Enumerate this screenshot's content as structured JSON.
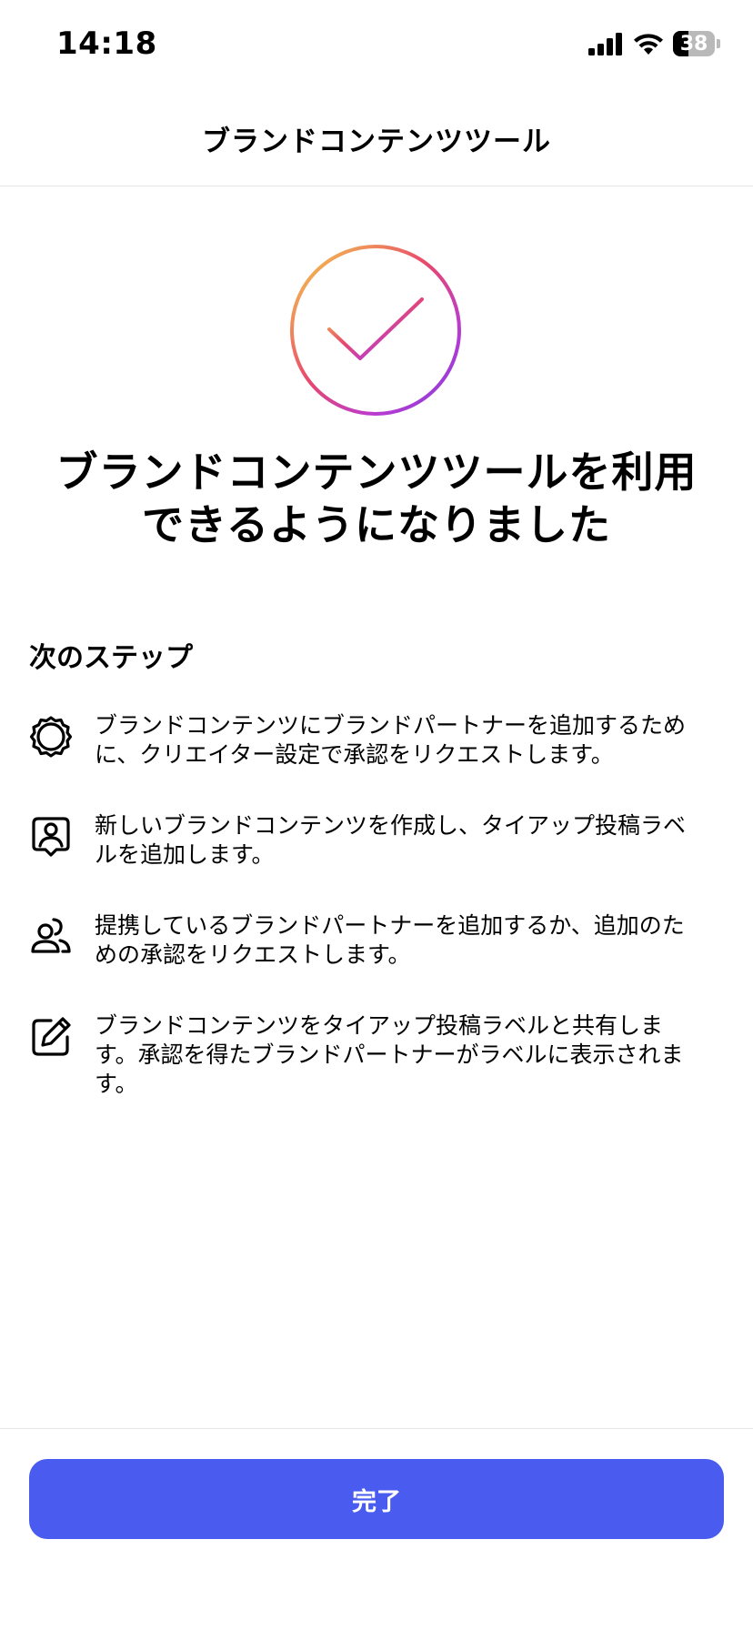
{
  "status_bar": {
    "time": "14:18",
    "battery_level": "38",
    "battery_fraction": 0.38
  },
  "header": {
    "title": "ブランドコンテンツツール"
  },
  "hero": {
    "icon": "gradient-check-circle-icon",
    "gradient_colors": [
      "#f5d34a",
      "#e8486c",
      "#b93bd0",
      "#7a3fe0"
    ],
    "headline_line1": "ブランドコンテンツツールを利用",
    "headline_line2": "できるようになりました"
  },
  "next_steps": {
    "title": "次のステップ",
    "items": [
      {
        "icon": "gear-icon",
        "line1": "ブランドコンテンツにブランドパートナーを追加するため",
        "line2": "に、クリエイター設定で承認をリクエストします。"
      },
      {
        "icon": "portrait-tag-icon",
        "line1": "新しいブランドコンテンツを作成し、タイアップ投稿ラベ",
        "line2": "ルを追加します。"
      },
      {
        "icon": "users-icon",
        "line1": "提携しているブランドパートナーを追加するか、追加のた",
        "line2": "めの承認をリクエストします。"
      },
      {
        "icon": "edit-icon",
        "line1": "ブランドコンテンツをタイアップ投稿ラベルと共有しま",
        "line2": "す。承認を得たブランドパートナーがラベルに表示されま",
        "line3": "す。"
      }
    ]
  },
  "footer": {
    "done_label": "完了",
    "button_color": "#4a5cf0"
  }
}
